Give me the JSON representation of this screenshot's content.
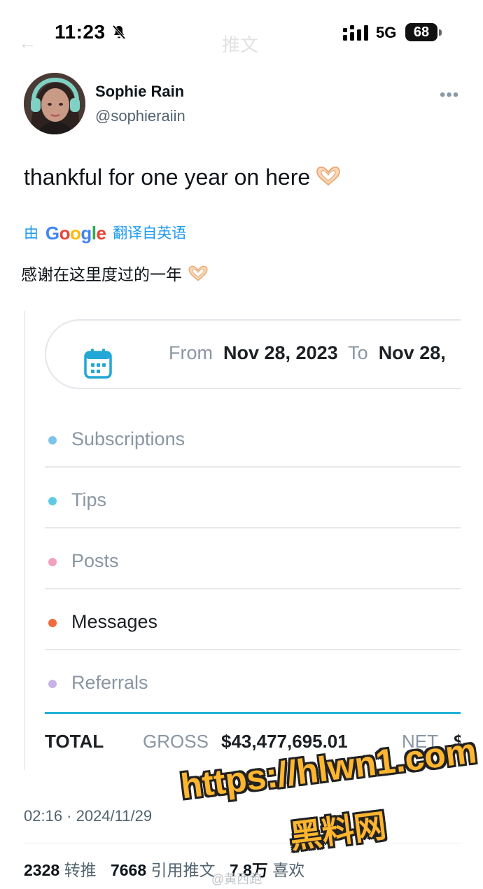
{
  "status_bar": {
    "time": "11:23",
    "network": "5G",
    "battery": "68"
  },
  "nav": {
    "back_glyph": "←",
    "title": "推文"
  },
  "user": {
    "display_name": "Sophie Rain",
    "handle": "@sophieraiin",
    "more_glyph": "•••"
  },
  "tweet": {
    "text": "thankful for one year on here",
    "emoji_name": "heart-hands-icon",
    "translate_prefix": "由",
    "translate_brand": [
      "G",
      "o",
      "o",
      "g",
      "l",
      "e"
    ],
    "translate_suffix": "翻译自英语",
    "translated_text": "感谢在这里度过的一年"
  },
  "earnings_card": {
    "from_label": "From",
    "from_date": "Nov 28, 2023",
    "to_label": "To",
    "to_date": "Nov 28,",
    "categories": [
      {
        "label": "Subscriptions",
        "color": "#7cc4ea"
      },
      {
        "label": "Tips",
        "color": "#5fcbe3"
      },
      {
        "label": "Posts",
        "color": "#f2a1bd"
      },
      {
        "label": "Messages",
        "color": "#f26b3a"
      },
      {
        "label": "Referrals",
        "color": "#c9b3e6"
      }
    ],
    "total_label": "TOTAL",
    "gross_label": "GROSS",
    "gross_value": "$43,477,695.01",
    "net_label": "NET",
    "net_value": "$",
    "accent_color": "#22b3d6"
  },
  "timestamp": "02:16 · 2024/11/29",
  "stats": {
    "retweets": "2328",
    "retweets_label": "转推",
    "quotes": "7668",
    "quotes_label": "引用推文",
    "likes": "7.8万",
    "likes_label": "喜欢"
  },
  "watermark": {
    "url": "https://hlwn1.com",
    "name": "黑料网",
    "weibo": "@黄西跑"
  }
}
